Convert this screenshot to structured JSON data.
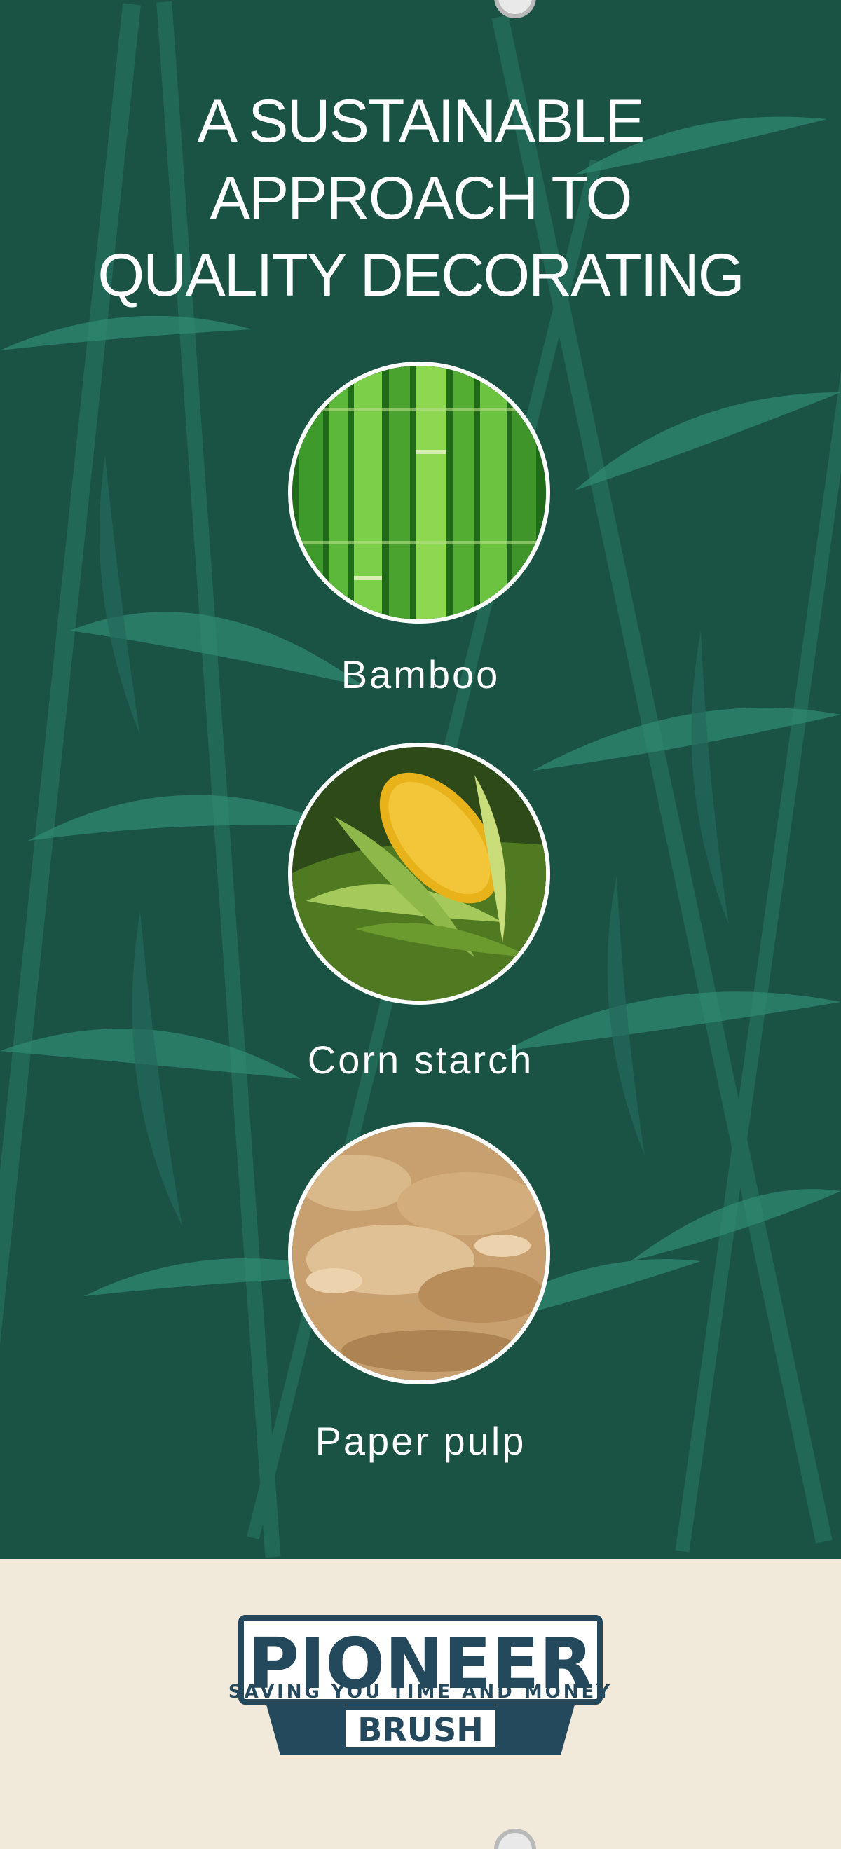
{
  "headline": {
    "lines": [
      "A SUSTAINABLE",
      "APPROACH TO",
      "QUALITY DECORATING"
    ]
  },
  "materials": [
    {
      "label": "Bamboo",
      "image": "bamboo-stalks-photo"
    },
    {
      "label": "Corn starch",
      "image": "corn-cob-photo"
    },
    {
      "label": "Paper pulp",
      "image": "paper-pulp-photo"
    }
  ],
  "brand": {
    "name_top": "PIONEER",
    "name_bottom": "BRUSH",
    "tagline": "SAVING YOU TIME AND MONEY"
  },
  "colors": {
    "panel_green": "#1a5244",
    "leaf_green": "#2a7a66",
    "cream": "#f1eadb",
    "brand_navy": "#24485c",
    "text_white": "#ffffff"
  }
}
